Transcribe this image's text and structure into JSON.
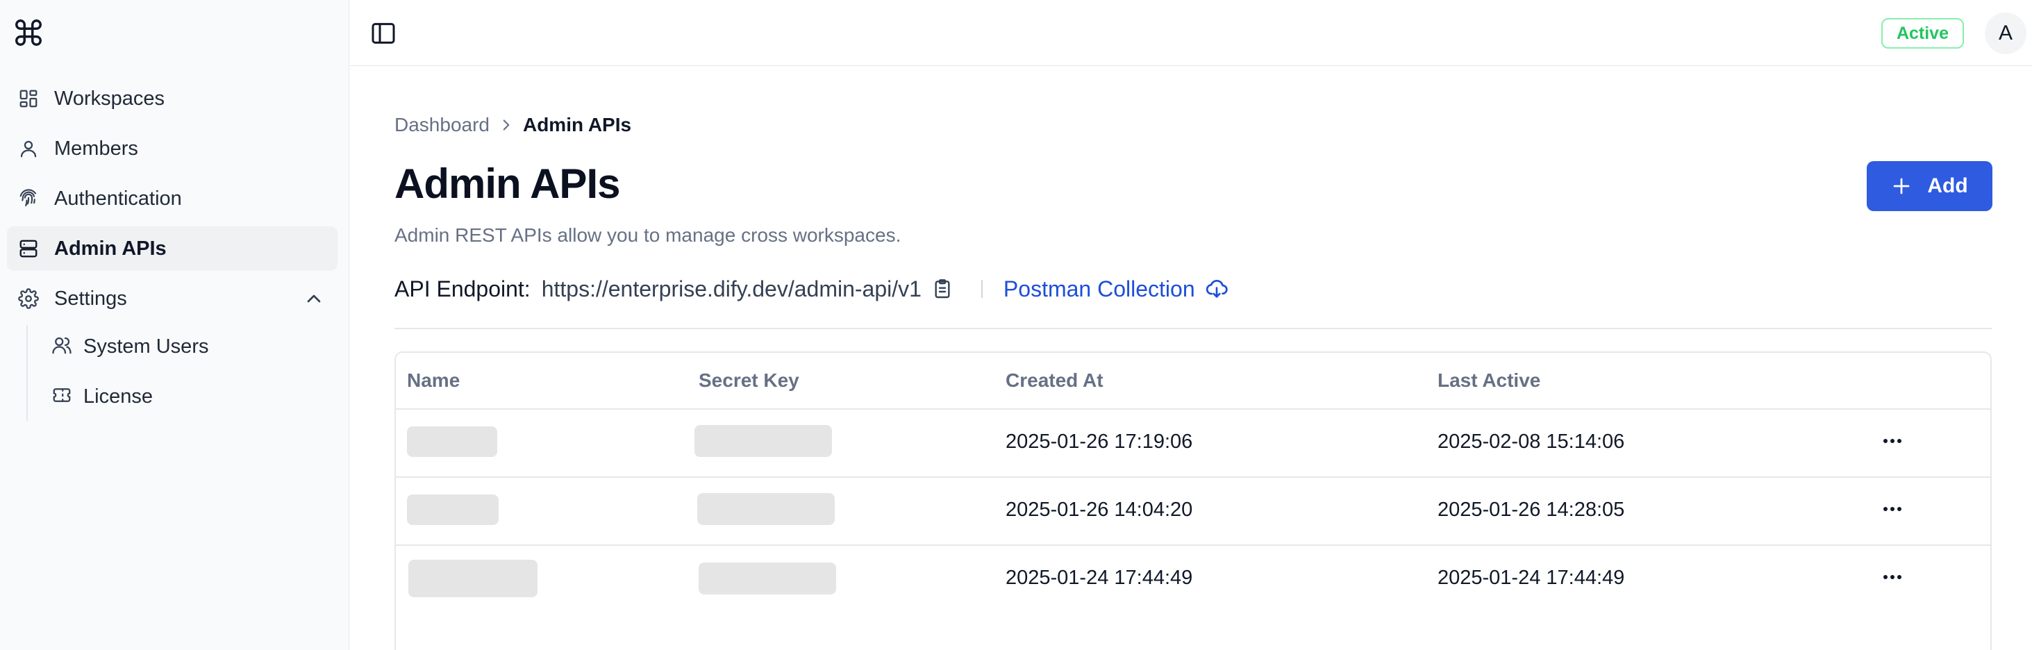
{
  "sidebar": {
    "logo": "command-icon",
    "items": [
      {
        "label": "Workspaces",
        "icon": "grid-icon"
      },
      {
        "label": "Members",
        "icon": "user-icon"
      },
      {
        "label": "Authentication",
        "icon": "fingerprint-icon"
      },
      {
        "label": "Admin APIs",
        "icon": "server-icon",
        "active": true
      },
      {
        "label": "Settings",
        "icon": "gear-icon",
        "expanded": true
      }
    ],
    "settings_children": [
      {
        "label": "System Users",
        "icon": "users-icon"
      },
      {
        "label": "License",
        "icon": "ticket-icon"
      }
    ]
  },
  "header": {
    "status": "Active",
    "avatar_initial": "A"
  },
  "breadcrumb": {
    "parent": "Dashboard",
    "current": "Admin APIs"
  },
  "page": {
    "title": "Admin APIs",
    "description": "Admin REST APIs allow you to manage cross workspaces.",
    "add_label": "Add"
  },
  "endpoint": {
    "label": "API Endpoint:",
    "url": "https://enterprise.dify.dev/admin-api/v1",
    "postman_label": "Postman Collection"
  },
  "table": {
    "columns": [
      "Name",
      "Secret Key",
      "Created At",
      "Last Active"
    ],
    "rows": [
      {
        "created_at": "2025-01-26 17:19:06",
        "last_active": "2025-02-08 15:14:06"
      },
      {
        "created_at": "2025-01-26 14:04:20",
        "last_active": "2025-01-26 14:28:05"
      },
      {
        "created_at": "2025-01-24 17:44:49",
        "last_active": "2025-01-24 17:44:49"
      }
    ]
  },
  "colors": {
    "accent": "#2f5be0",
    "link": "#1d4ed8",
    "status_green": "#22c55e"
  }
}
